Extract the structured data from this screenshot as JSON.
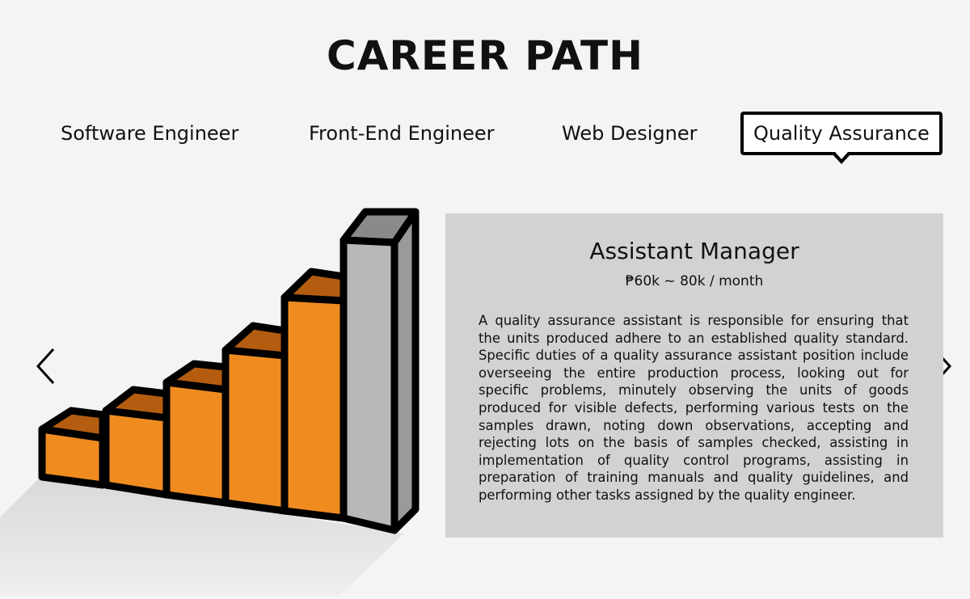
{
  "page": {
    "title": "CAREER PATH"
  },
  "tabs": [
    {
      "label": "Software Engineer",
      "active": false
    },
    {
      "label": "Front-End Engineer",
      "active": false
    },
    {
      "label": "Web Designer",
      "active": false
    },
    {
      "label": "Quality Assurance",
      "active": true
    }
  ],
  "navigation": {
    "prev_icon": "chevron-left-icon",
    "next_icon": "chevron-right-icon"
  },
  "illustration": {
    "icon": "staircase-bar-chart-icon",
    "bar_color": "#f08c1f",
    "highlight_color": "#b8b8b8",
    "bar_count": 6,
    "highlighted_bar": 6
  },
  "detail": {
    "title": "Assistant Manager",
    "salary": "₱60k ~ 80k / month",
    "description": "A quality assurance assistant is responsible for ensuring that the units produced adhere to an established quality standard. Specific duties of a quality assurance assistant position include overseeing the entire production process, looking out for specific problems, minutely observing the units of goods produced for visible defects, performing various tests on the samples drawn, noting down observations, accepting and rejecting lots on the basis of samples checked, assisting in implementation of quality control programs, assisting in preparation of training manuals and quality guidelines, and performing other tasks assigned by the quality engineer."
  }
}
